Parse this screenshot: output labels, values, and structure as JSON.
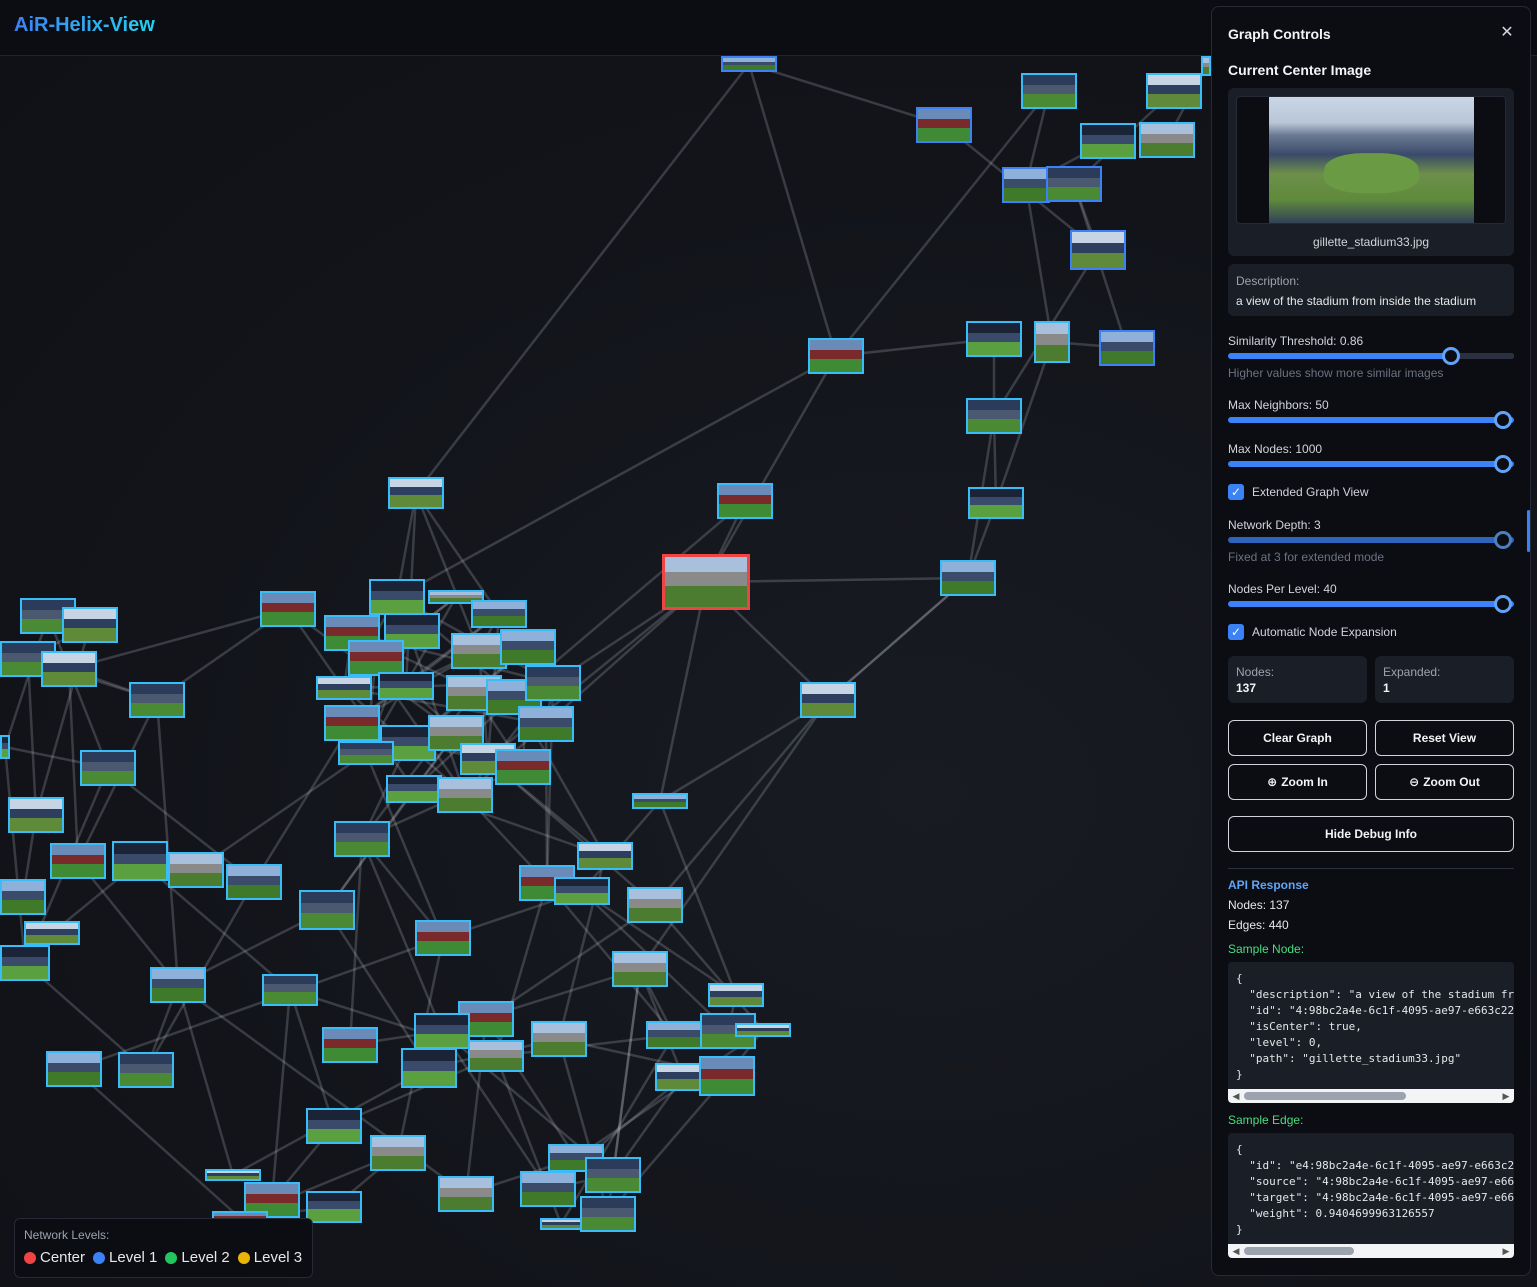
{
  "app": {
    "title": "AiR-Helix-View"
  },
  "legend": {
    "title": "Network Levels:",
    "items": [
      {
        "label": "Center",
        "color": "#ef4444"
      },
      {
        "label": "Level 1",
        "color": "#3b82f6"
      },
      {
        "label": "Level 2",
        "color": "#22c55e"
      },
      {
        "label": "Level 3",
        "color": "#eab308"
      }
    ]
  },
  "panel": {
    "title": "Graph Controls",
    "close_icon": "close-icon",
    "current_center_title": "Current Center Image",
    "center_filename": "gillette_stadium33.jpg",
    "description_label": "Description:",
    "description_text": "a view of the stadium from inside the stadium",
    "similarity_label": "Similarity Threshold: 0.86",
    "similarity_value": 0.86,
    "similarity_hint": "Higher values show more similar images",
    "max_neighbors_label": "Max Neighbors: 50",
    "max_neighbors_value": 50,
    "max_nodes_label": "Max Nodes: 1000",
    "max_nodes_value": 1000,
    "extended_view_label": "Extended Graph View",
    "extended_view_checked": true,
    "network_depth_label": "Network Depth: 3",
    "network_depth_value": 3,
    "network_depth_hint": "Fixed at 3 for extended mode",
    "nodes_per_level_label": "Nodes Per Level: 40",
    "nodes_per_level_value": 40,
    "auto_expand_label": "Automatic Node Expansion",
    "auto_expand_checked": true,
    "stats": {
      "nodes_label": "Nodes:",
      "nodes_value": "137",
      "expanded_label": "Expanded:",
      "expanded_value": "1"
    },
    "buttons": {
      "clear_graph": "Clear Graph",
      "reset_view": "Reset View",
      "zoom_in": "Zoom In",
      "zoom_out": "Zoom Out",
      "hide_debug": "Hide Debug Info"
    },
    "api": {
      "title": "API Response",
      "nodes_line": "Nodes: 137",
      "edges_line": "Edges: 440",
      "sample_node_label": "Sample Node:",
      "sample_node_code": "{\n  \"description\": \"a view of the stadium fr\n  \"id\": \"4:98bc2a4e-6c1f-4095-ae97-e663c22\n  \"isCenter\": true,\n  \"level\": 0,\n  \"path\": \"gillette_stadium33.jpg\"\n}",
      "sample_edge_label": "Sample Edge:",
      "sample_edge_code": "{\n  \"id\": \"e4:98bc2a4e-6c1f-4095-ae97-e663c2\n  \"source\": \"4:98bc2a4e-6c1f-4095-ae97-e66\n  \"target\": \"4:98bc2a4e-6c1f-4095-ae97-e66\n  \"weight\": 0.9404699963126557\n}"
    }
  }
}
